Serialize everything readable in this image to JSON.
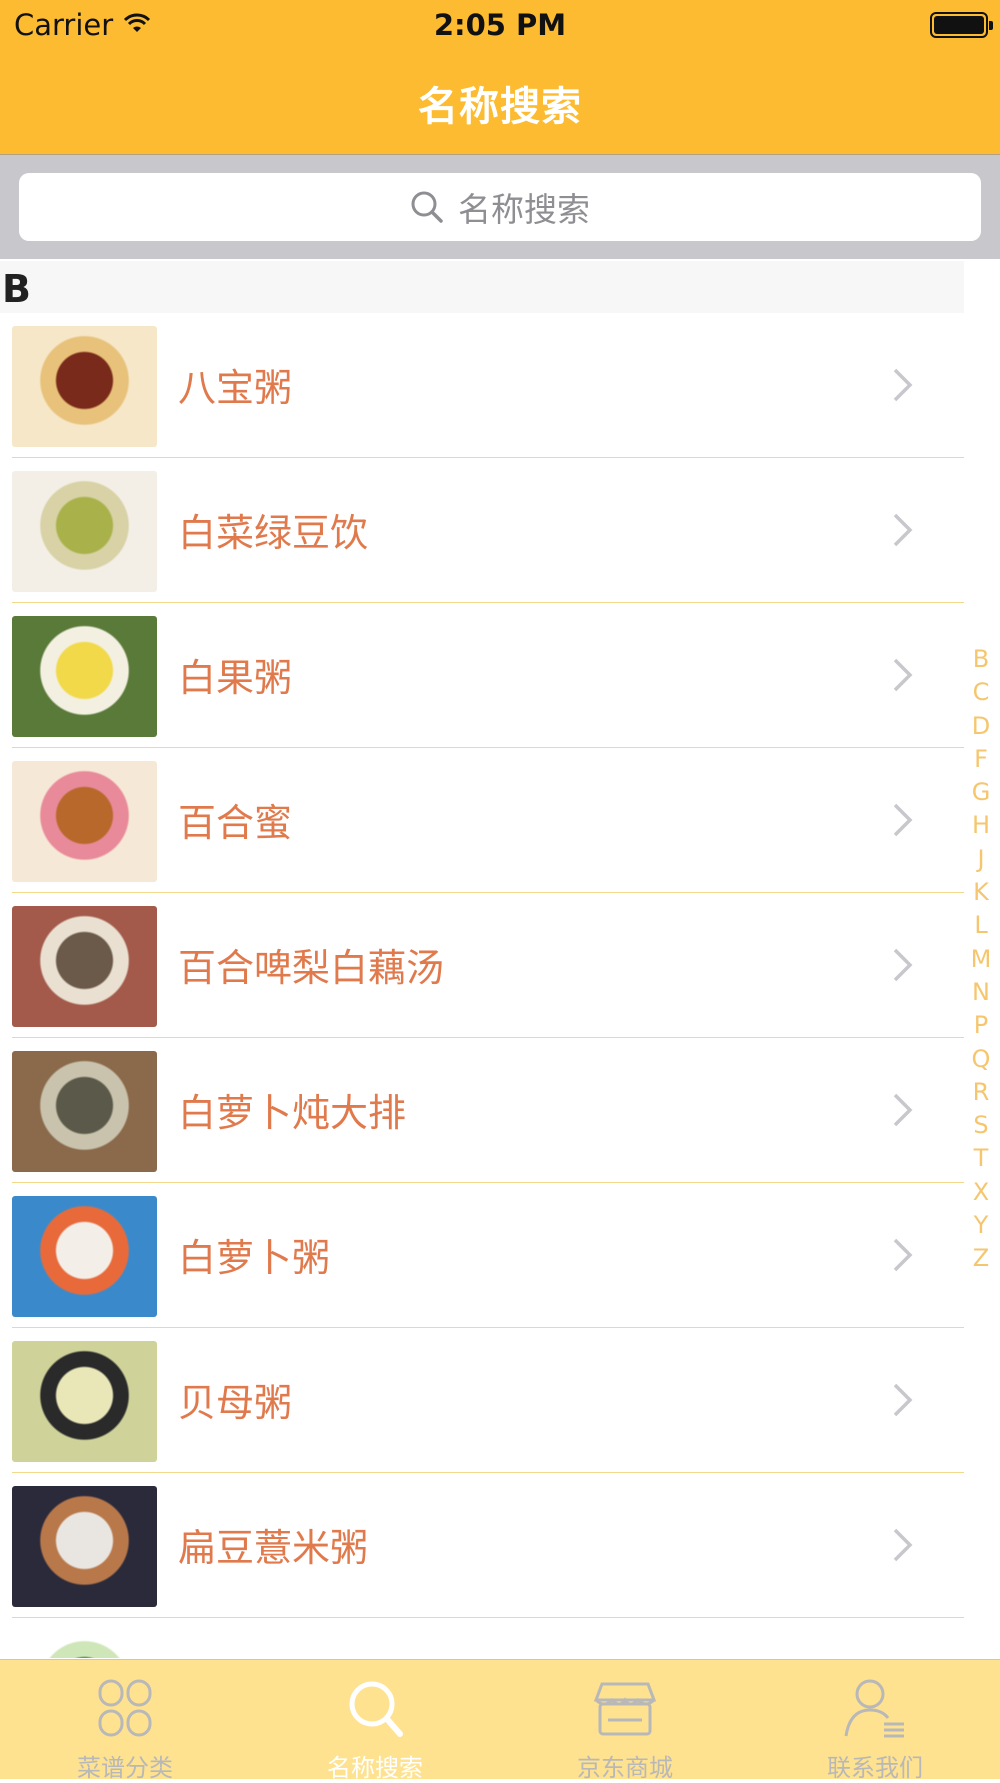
{
  "status_bar": {
    "carrier": "Carrier",
    "time": "2:05 PM"
  },
  "nav": {
    "title": "名称搜索"
  },
  "search": {
    "placeholder": "名称搜索"
  },
  "section": {
    "header": "B"
  },
  "items": [
    {
      "title": "八宝粥",
      "thumb_colors": [
        "#7a2a1a",
        "#e8c27a",
        "#f5e7c8"
      ]
    },
    {
      "title": "白菜绿豆饮",
      "thumb_colors": [
        "#a9b24a",
        "#d8d2a6",
        "#f3efe6"
      ]
    },
    {
      "title": "白果粥",
      "thumb_colors": [
        "#f2d94a",
        "#f3f0e2",
        "#5a7a3a"
      ]
    },
    {
      "title": "百合蜜",
      "thumb_colors": [
        "#b8682a",
        "#e98a9b",
        "#f6e8d6"
      ]
    },
    {
      "title": "百合啤梨白藕汤",
      "thumb_colors": [
        "#6b5a4a",
        "#e9e0d2",
        "#a35a4a"
      ]
    },
    {
      "title": "白萝卜炖大排",
      "thumb_colors": [
        "#5b5a4a",
        "#c9c3ae",
        "#8a6a4a"
      ]
    },
    {
      "title": "白萝卜粥",
      "thumb_colors": [
        "#f3efe8",
        "#e86a3a",
        "#3a8acb"
      ]
    },
    {
      "title": "贝母粥",
      "thumb_colors": [
        "#e9e7b8",
        "#2a2a2a",
        "#cfd39a"
      ]
    },
    {
      "title": "扁豆薏米粥",
      "thumb_colors": [
        "#e9e6e2",
        "#b8784a",
        "#2a2a3a"
      ]
    },
    {
      "title": "",
      "thumb_colors": [
        "#4a8a3a",
        "#cfe6b8",
        "#ffffff"
      ]
    }
  ],
  "index_letters": [
    "B",
    "C",
    "D",
    "F",
    "G",
    "H",
    "J",
    "K",
    "L",
    "M",
    "N",
    "P",
    "Q",
    "R",
    "S",
    "T",
    "X",
    "Y",
    "Z"
  ],
  "tabs": [
    {
      "label": "菜谱分类",
      "icon": "category-grid-icon",
      "active": false
    },
    {
      "label": "名称搜索",
      "icon": "search-icon",
      "active": true
    },
    {
      "label": "京东商城",
      "icon": "store-icon",
      "active": false
    },
    {
      "label": "联系我们",
      "icon": "contact-person-icon",
      "active": false
    }
  ],
  "colors": {
    "accent": "#fcbb30",
    "item_text": "#e07a4d",
    "tab_bg": "#fee28f",
    "index_text": "#f5c66e"
  }
}
